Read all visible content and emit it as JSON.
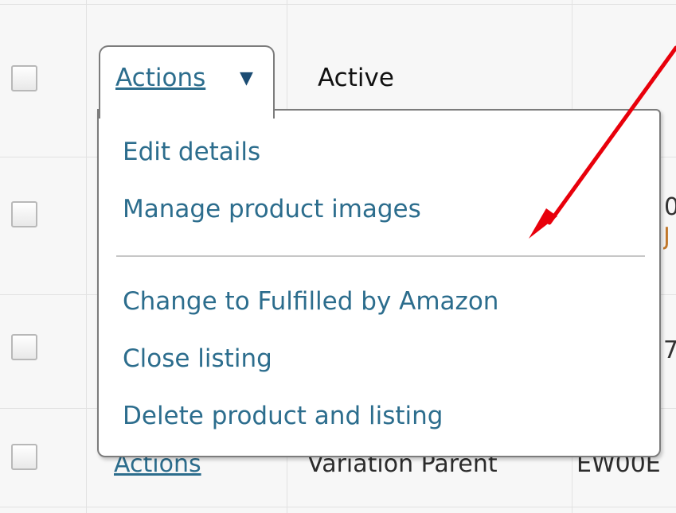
{
  "table": {
    "rows": [
      {
        "status": "Active"
      },
      {
        "partial_value": "0",
        "partial_orange": "J"
      },
      {
        "partial_value": "7"
      },
      {
        "actions_label": "Actions",
        "status": "Variation Parent",
        "sku_partial": "EW00E"
      }
    ]
  },
  "actions_dropdown": {
    "trigger_label": "Actions",
    "caret_glyph": "▼",
    "menu": {
      "group1": [
        "Edit details",
        "Manage product images"
      ],
      "group2": [
        "Change to Fulfilled by Amazon",
        "Close listing",
        "Delete product and listing"
      ]
    }
  },
  "colors": {
    "link": "#2c6d8d",
    "annotation_arrow": "#e8000b"
  }
}
